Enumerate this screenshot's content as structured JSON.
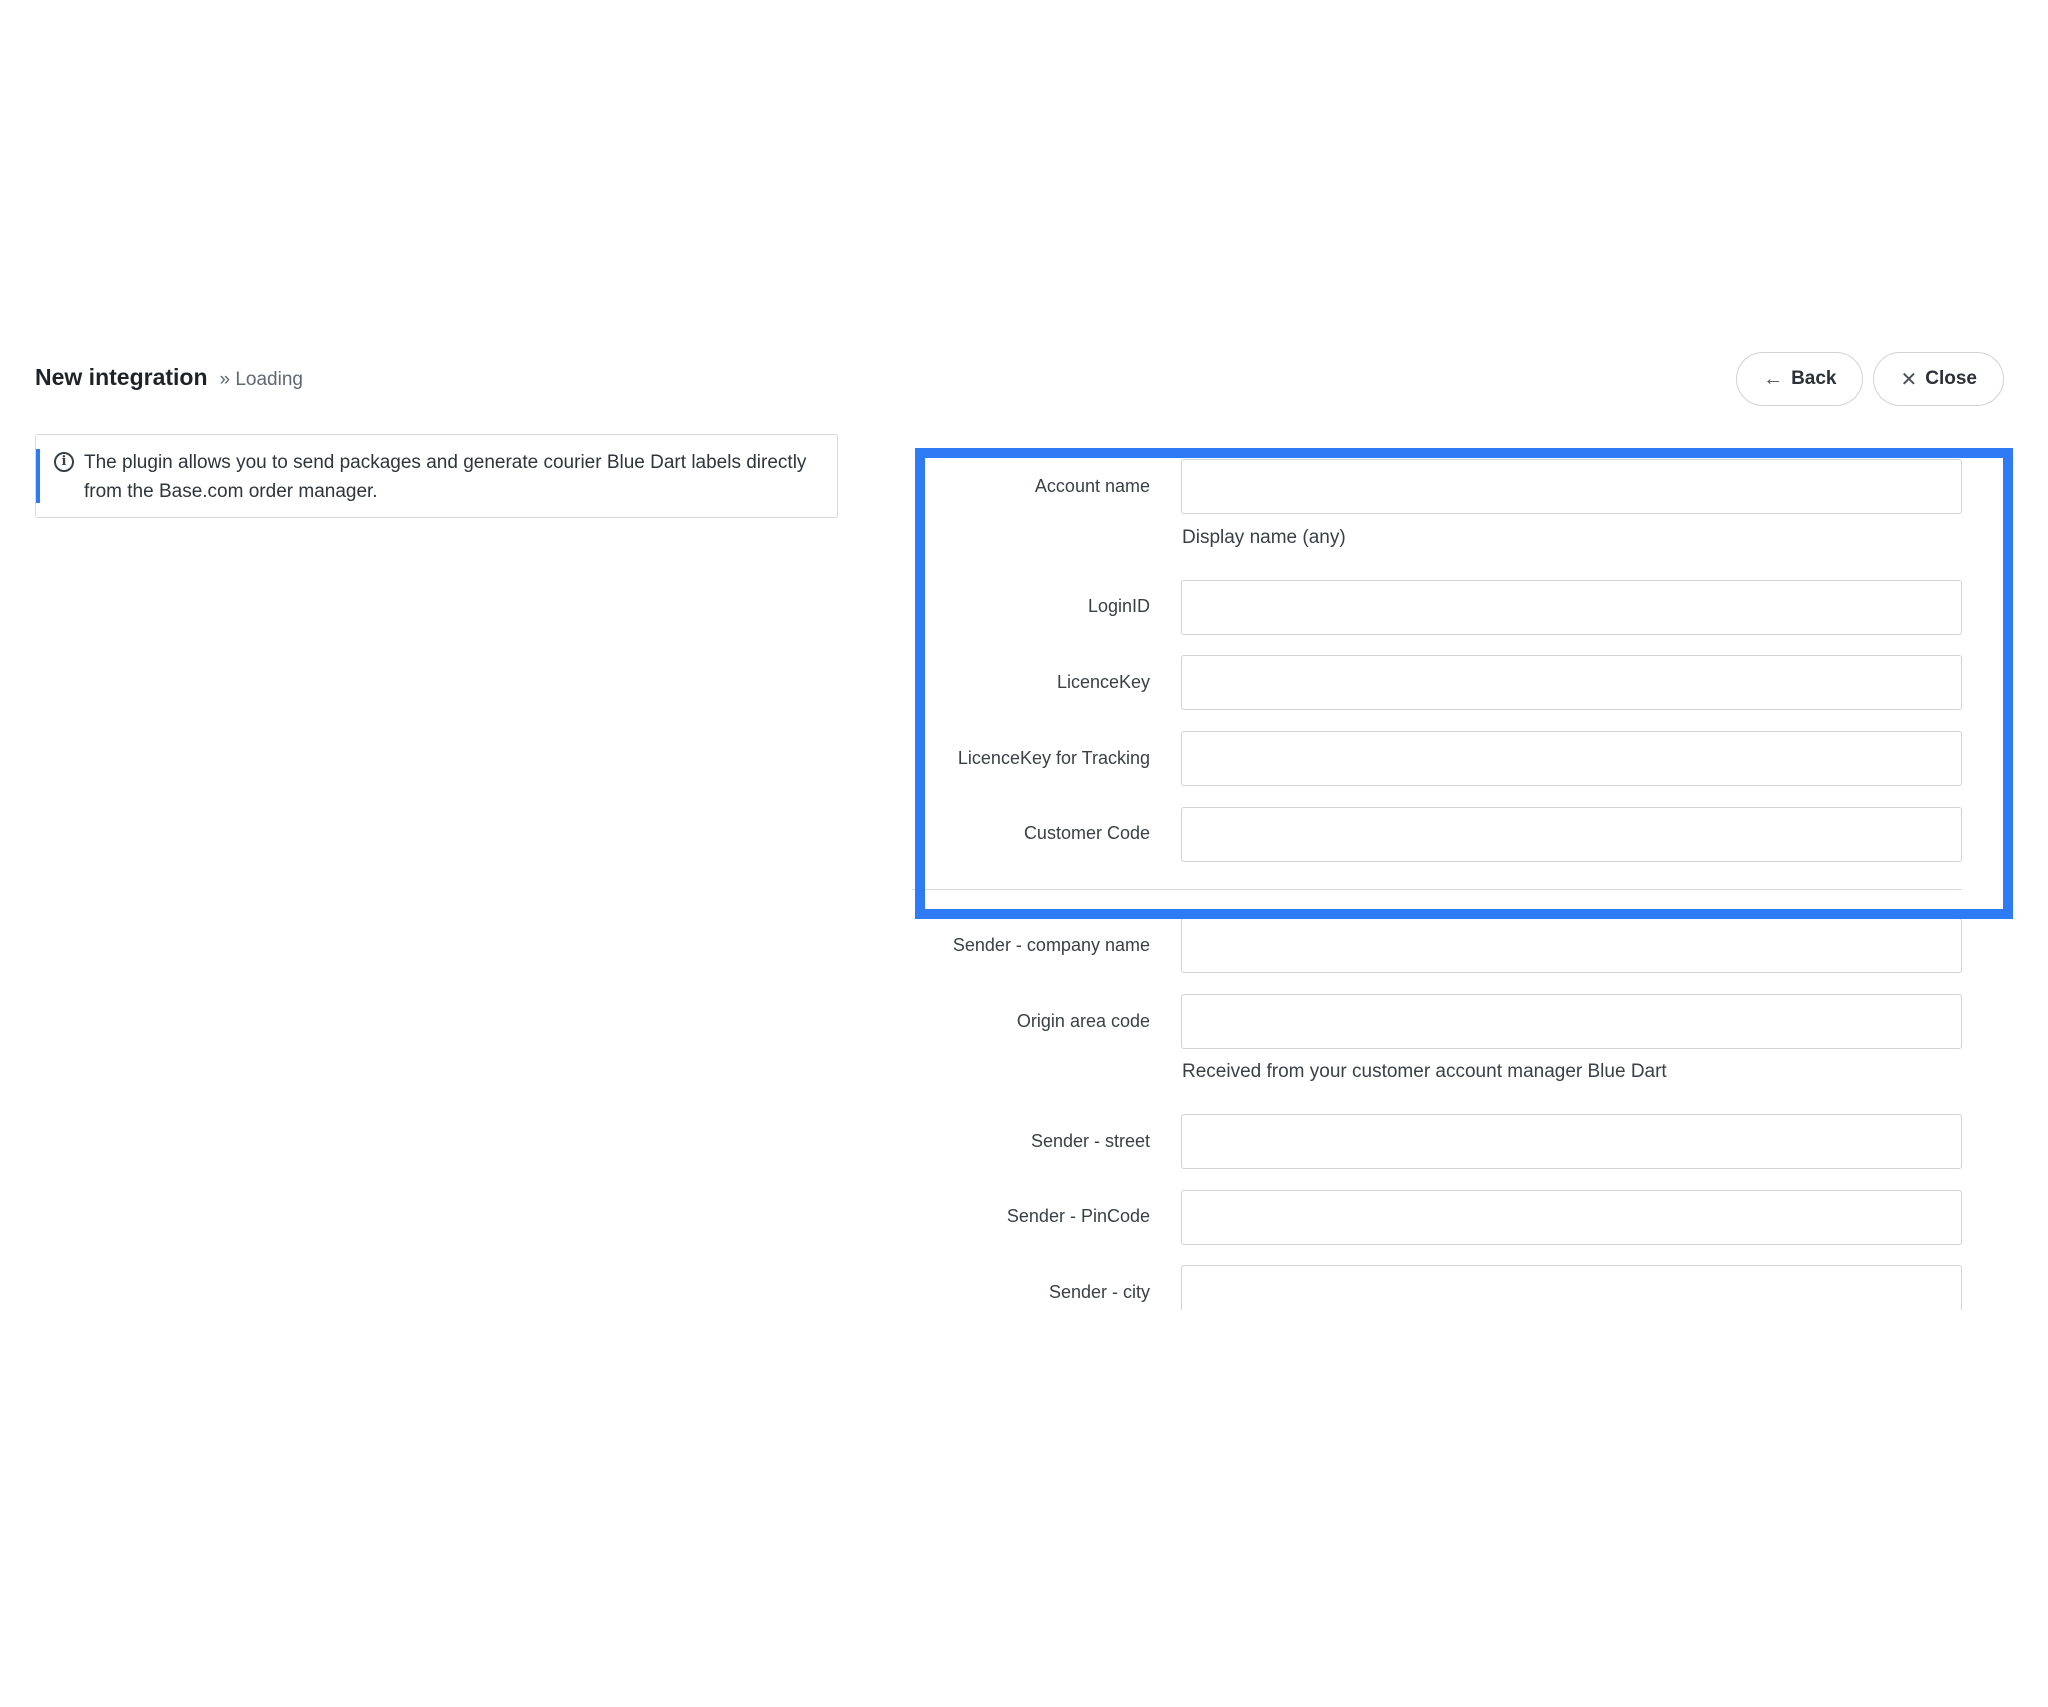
{
  "header": {
    "title": "New integration",
    "subtitle": "» Loading",
    "back_label": "Back",
    "close_label": "Close",
    "back_icon": "arrow-left-icon",
    "close_icon": "close-icon"
  },
  "info": {
    "icon": "info-icon",
    "text": "The plugin allows you to send packages and generate courier Blue Dart labels directly from the Base.com order manager."
  },
  "form": {
    "account_name": {
      "label": "Account name",
      "value": "",
      "hint": "Display name (any)"
    },
    "login_id": {
      "label": "LoginID",
      "value": ""
    },
    "licence_key": {
      "label": "LicenceKey",
      "value": ""
    },
    "licence_key_tracking": {
      "label": "LicenceKey for Tracking",
      "value": ""
    },
    "customer_code": {
      "label": "Customer Code",
      "value": ""
    },
    "sender_company": {
      "label": "Sender - company name",
      "value": ""
    },
    "origin_area_code": {
      "label": "Origin area code",
      "value": "",
      "hint": "Received from your customer account manager Blue Dart"
    },
    "sender_street": {
      "label": "Sender - street",
      "value": ""
    },
    "sender_pincode": {
      "label": "Sender - PinCode",
      "value": ""
    },
    "sender_city": {
      "label": "Sender - city",
      "value": ""
    }
  },
  "colors": {
    "accent": "#2f7bf5",
    "border": "#cfd3d8",
    "text": "#2b3138"
  }
}
